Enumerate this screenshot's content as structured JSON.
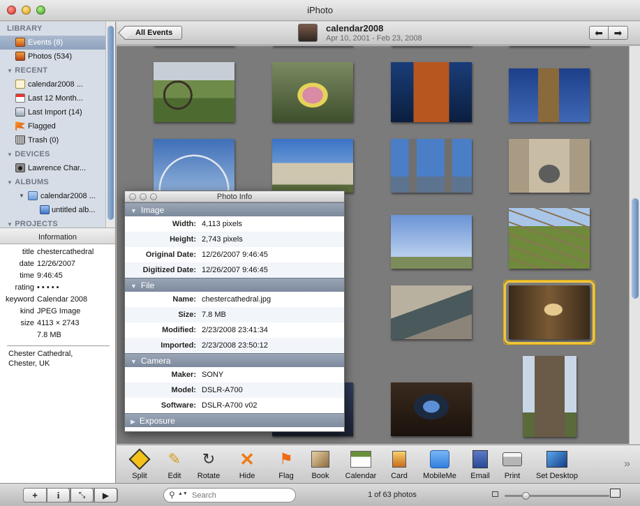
{
  "app": {
    "title": "iPhoto"
  },
  "sidebar": {
    "sections": {
      "library": "LIBRARY",
      "recent": "RECENT",
      "devices": "DEVICES",
      "albums": "ALBUMS",
      "projects": "PROJECTS"
    },
    "library_items": [
      {
        "label": "Events (8)",
        "icon": "events-icon",
        "selected": true
      },
      {
        "label": "Photos (534)",
        "icon": "photos-icon",
        "selected": false
      }
    ],
    "recent_items": [
      {
        "label": "calendar2008 ...",
        "icon": "event-icon"
      },
      {
        "label": "Last 12 Month...",
        "icon": "calendar-icon"
      },
      {
        "label": "Last Import (14)",
        "icon": "import-icon"
      },
      {
        "label": "Flagged",
        "icon": "flag-icon"
      },
      {
        "label": "Trash (0)",
        "icon": "trash-icon"
      }
    ],
    "device_items": [
      {
        "label": "Lawrence Char...",
        "icon": "camera-icon"
      }
    ],
    "album_items": [
      {
        "label": "calendar2008 ...",
        "icon": "folder-icon"
      },
      {
        "label": "untitled alb...",
        "icon": "album-icon"
      }
    ]
  },
  "information": {
    "header": "Information",
    "rows": [
      {
        "key": "title",
        "value": "chestercathedral"
      },
      {
        "key": "date",
        "value": "12/26/2007"
      },
      {
        "key": "time",
        "value": "9:46:45"
      },
      {
        "key": "rating",
        "value": "• • • • •"
      },
      {
        "key": "keyword",
        "value": "Calendar 2008"
      },
      {
        "key": "kind",
        "value": "JPEG Image"
      },
      {
        "key": "size",
        "value": "4113 × 2743"
      },
      {
        "key": "",
        "value": "7.8 MB"
      }
    ],
    "description": "Chester Cathedral,\nChester, UK"
  },
  "header": {
    "back_button": "All Events",
    "event_title": "calendar2008",
    "event_dates": "Apr 10, 2001 - Feb 23, 2008",
    "prev_icon": "arrow-left-icon",
    "next_icon": "arrow-right-icon"
  },
  "photo_info": {
    "title": "Photo Info",
    "sections": [
      {
        "name": "Image",
        "rows": [
          {
            "key": "Width:",
            "value": "4,113 pixels"
          },
          {
            "key": "Height:",
            "value": "2,743 pixels"
          },
          {
            "key": "Original Date:",
            "value": "12/26/2007 9:46:45"
          },
          {
            "key": "Digitized Date:",
            "value": "12/26/2007 9:46:45"
          }
        ]
      },
      {
        "name": "File",
        "rows": [
          {
            "key": "Name:",
            "value": "chestercathedral.jpg"
          },
          {
            "key": "Size:",
            "value": "7.8 MB"
          },
          {
            "key": "Modified:",
            "value": "2/23/2008 23:41:34"
          },
          {
            "key": "Imported:",
            "value": "2/23/2008 23:50:12"
          }
        ]
      },
      {
        "name": "Camera",
        "rows": [
          {
            "key": "Maker:",
            "value": "SONY"
          },
          {
            "key": "Model:",
            "value": "DSLR-A700"
          },
          {
            "key": "Software:",
            "value": "DSLR-A700 v02"
          }
        ]
      },
      {
        "name": "Exposure",
        "rows": []
      }
    ]
  },
  "toolbar": {
    "tools": [
      {
        "label": "Split",
        "icon": "split-icon"
      },
      {
        "label": "Edit",
        "icon": "pencil-icon"
      },
      {
        "label": "Rotate",
        "icon": "rotate-icon"
      },
      {
        "label": "Hide",
        "icon": "hide-x-icon"
      },
      {
        "label": "Flag",
        "icon": "flag-icon"
      },
      {
        "label": "Book",
        "icon": "book-icon"
      },
      {
        "label": "Calendar",
        "icon": "calendar-icon"
      },
      {
        "label": "Card",
        "icon": "card-icon"
      },
      {
        "label": "MobileMe",
        "icon": "cloud-icon"
      },
      {
        "label": "Email",
        "icon": "email-icon"
      },
      {
        "label": "Print",
        "icon": "printer-icon"
      },
      {
        "label": "Set Desktop",
        "icon": "desktop-icon"
      }
    ]
  },
  "bottom": {
    "search_placeholder": "Search",
    "photo_count": "1 of 63 photos",
    "zoom_level": 0.2
  },
  "colors": {
    "selection_outline": "#f1c637",
    "sidebar_bg": "#d6dde6",
    "grid_bg": "#7b7b7b",
    "section_bar": "#8a96a8"
  }
}
